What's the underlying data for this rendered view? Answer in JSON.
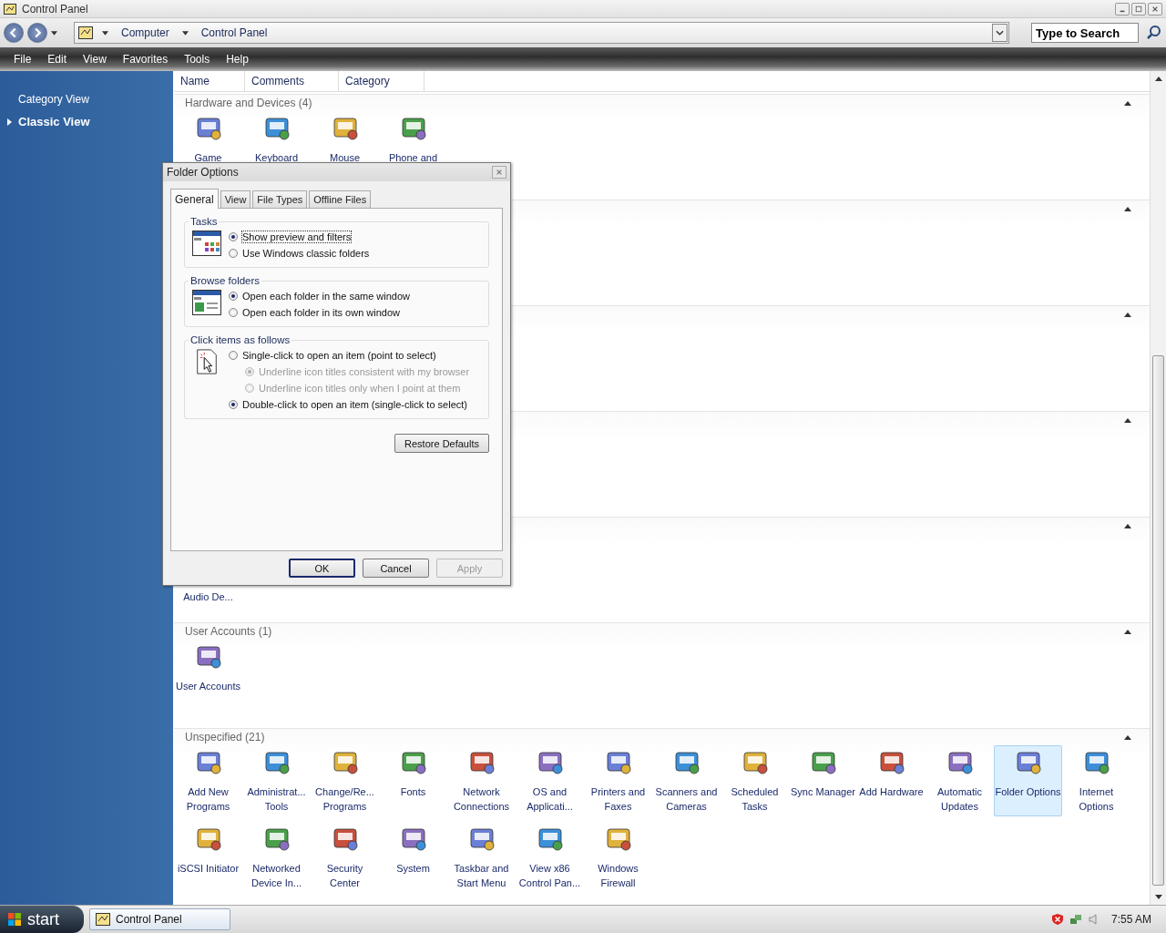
{
  "window": {
    "title": "Control Panel"
  },
  "address_bar": {
    "breadcrumbs": [
      "Computer",
      "Control Panel"
    ]
  },
  "search": {
    "placeholder": "Type to Search"
  },
  "menu": [
    "File",
    "Edit",
    "View",
    "Favorites",
    "Tools",
    "Help"
  ],
  "sidebar": {
    "items": [
      {
        "label": "Category View",
        "selected": false
      },
      {
        "label": "Classic View",
        "selected": true
      }
    ]
  },
  "columns": [
    "Name",
    "Comments",
    "Category"
  ],
  "groups": [
    {
      "title": "Hardware and Devices (4)",
      "expanded": true,
      "items": [
        {
          "label": "Game",
          "kind": "applet",
          "selected": false
        },
        {
          "label": "Keyboard",
          "kind": "applet",
          "selected": false
        },
        {
          "label": "Mouse",
          "kind": "applet",
          "selected": false
        },
        {
          "label": "Phone and",
          "kind": "applet",
          "selected": false
        }
      ]
    },
    {
      "expanded": true
    },
    {
      "expanded": true
    },
    {
      "expanded": true
    },
    {
      "expanded": true,
      "items": [
        {
          "label": "Audio De...",
          "kind": "clipped",
          "selected": false
        }
      ]
    },
    {
      "title": "User Accounts (1)",
      "expanded": true,
      "items": [
        {
          "label": "User Accounts",
          "kind": "applet",
          "selected": false
        }
      ]
    },
    {
      "title": "Unspecified (21)",
      "expanded": true,
      "items": [
        {
          "label": "Add New Programs",
          "kind": "applet",
          "selected": false
        },
        {
          "label": "Administrat... Tools",
          "kind": "applet",
          "selected": false
        },
        {
          "label": "Change/Re... Programs",
          "kind": "applet",
          "selected": false
        },
        {
          "label": "Fonts",
          "kind": "applet",
          "selected": false
        },
        {
          "label": "Network Connections",
          "kind": "applet",
          "selected": false
        },
        {
          "label": "OS and Applicati...",
          "kind": "applet",
          "selected": false
        },
        {
          "label": "Printers and Faxes",
          "kind": "applet",
          "selected": false
        },
        {
          "label": "Scanners and Cameras",
          "kind": "applet",
          "selected": false
        },
        {
          "label": "Scheduled Tasks",
          "kind": "applet",
          "selected": false
        },
        {
          "label": "Sync Manager",
          "kind": "applet",
          "selected": false
        },
        {
          "label": "Add Hardware",
          "kind": "applet",
          "selected": false
        },
        {
          "label": "Automatic Updates",
          "kind": "applet",
          "selected": false
        },
        {
          "label": "Folder Options",
          "kind": "applet",
          "selected": true
        },
        {
          "label": "Internet Options",
          "kind": "applet",
          "selected": false
        },
        {
          "label": "iSCSI Initiator",
          "kind": "applet",
          "selected": false
        },
        {
          "label": "Networked Device In...",
          "kind": "applet",
          "selected": false
        },
        {
          "label": "Security Center",
          "kind": "applet",
          "selected": false
        },
        {
          "label": "System",
          "kind": "applet",
          "selected": false
        },
        {
          "label": "Taskbar and Start Menu",
          "kind": "applet",
          "selected": false
        },
        {
          "label": "View x86 Control Pan...",
          "kind": "applet",
          "selected": false
        },
        {
          "label": "Windows Firewall",
          "kind": "applet",
          "selected": false
        }
      ]
    }
  ],
  "dialog": {
    "title": "Folder Options",
    "tabs": [
      {
        "label": "General",
        "selected": true
      },
      {
        "label": "View",
        "selected": false
      },
      {
        "label": "File Types",
        "selected": false
      },
      {
        "label": "Offline Files",
        "selected": false
      }
    ],
    "sections": [
      {
        "title": "Tasks",
        "options": [
          {
            "label": "Show preview and filters",
            "checked": true,
            "disabled": false,
            "focused": true
          },
          {
            "label": "Use Windows classic folders",
            "checked": false,
            "disabled": false,
            "focused": false
          }
        ]
      },
      {
        "title": "Browse folders",
        "options": [
          {
            "label": "Open each folder in the same window",
            "checked": true,
            "disabled": false,
            "focused": false
          },
          {
            "label": "Open each folder in its own window",
            "checked": false,
            "disabled": false,
            "focused": false
          }
        ]
      },
      {
        "title": "Click items as follows",
        "options": [
          {
            "label": "Single-click to open an item (point to select)",
            "checked": false,
            "disabled": false,
            "focused": false,
            "children": [
              {
                "label": "Underline icon titles consistent with my browser",
                "checked": true,
                "disabled": true,
                "focused": false
              },
              {
                "label": "Underline icon titles only when I point at them",
                "checked": false,
                "disabled": true,
                "focused": false
              }
            ]
          },
          {
            "label": "Double-click to open an item (single-click to select)",
            "checked": true,
            "disabled": false,
            "focused": false
          }
        ]
      }
    ],
    "restore_button": "Restore Defaults",
    "buttons": [
      {
        "label": "OK",
        "default": true,
        "disabled": false
      },
      {
        "label": "Cancel",
        "default": false,
        "disabled": false
      },
      {
        "label": "Apply",
        "default": false,
        "disabled": true
      }
    ]
  },
  "taskbar": {
    "start": "start",
    "tasks": [
      "Control Panel"
    ],
    "clock": "7:55 AM"
  }
}
